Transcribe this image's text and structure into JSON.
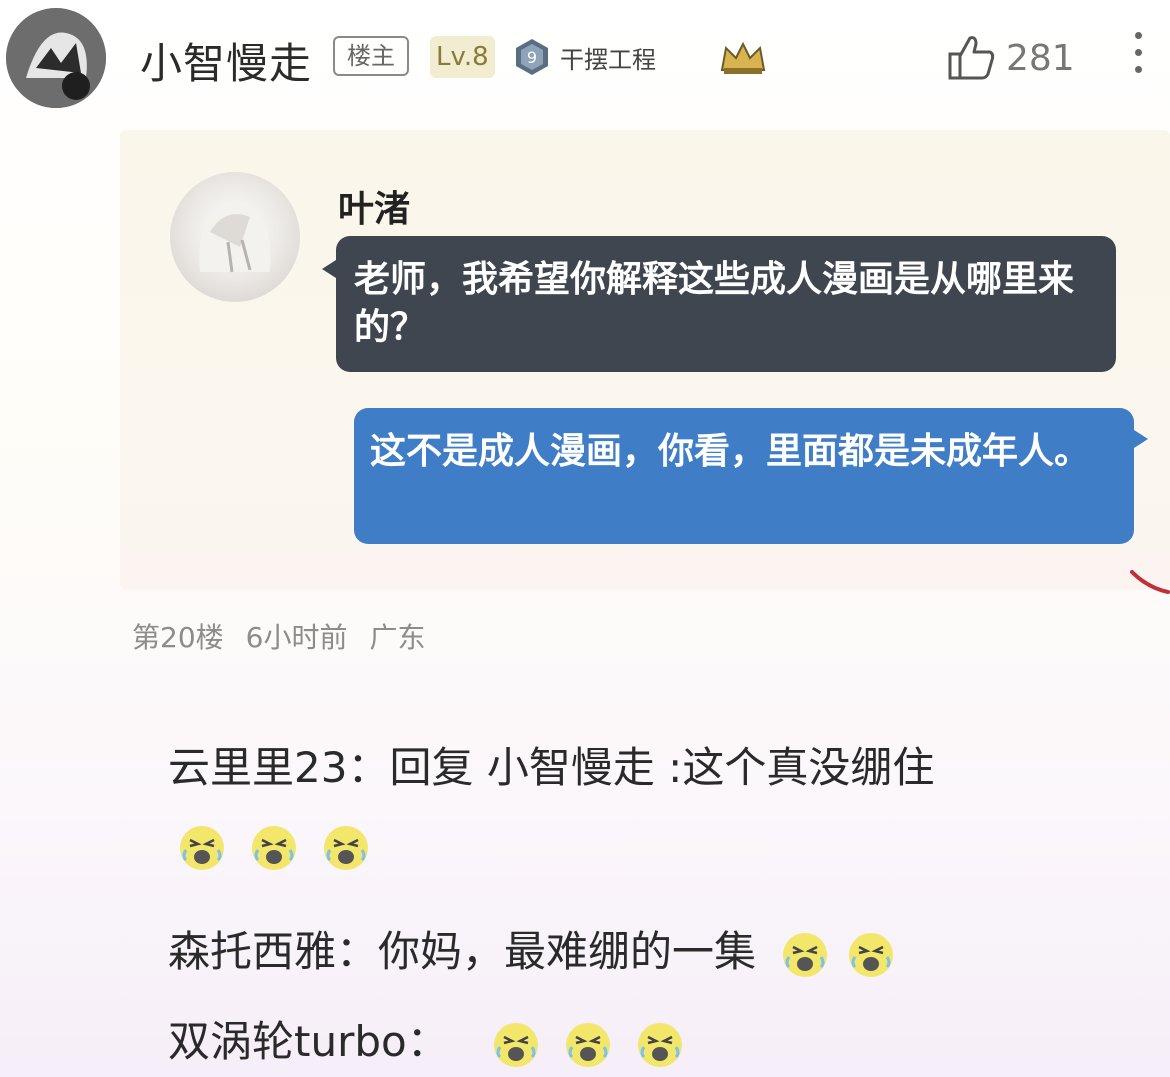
{
  "header": {
    "username": "小智慢走",
    "owner_badge": "楼主",
    "level_badge": "Lv.8",
    "group_badge_number": "9",
    "group_name": "干摆工程",
    "like_count": "281"
  },
  "quoted_chat": {
    "sender_name": "叶渚",
    "incoming_message": "老师，我希望你解释这些成人漫画是从哪里来的？",
    "outgoing_message": "这不是成人漫画，你看，里面都是未成年人。"
  },
  "meta": {
    "floor": "第20楼",
    "time": "6小时前",
    "location": "广东"
  },
  "replies": [
    {
      "user": "云里里23",
      "sep": "：",
      "text": "回复 小智慢走 :这个真没绷住"
    },
    {
      "user": "森托西雅",
      "sep": "：",
      "text": "你妈，最难绷的一集"
    },
    {
      "user": "双涡轮turbo",
      "sep": "：",
      "text": ""
    }
  ],
  "icons": {
    "like": "thumbs-up-icon",
    "more": "more-vertical-icon",
    "crown": "crown-icon",
    "emoji": "laughing-crying-emoji"
  },
  "colors": {
    "incoming_bubble": "#3f4650",
    "outgoing_bubble": "#3f7dc7",
    "meta_text": "#8c8c8c"
  }
}
